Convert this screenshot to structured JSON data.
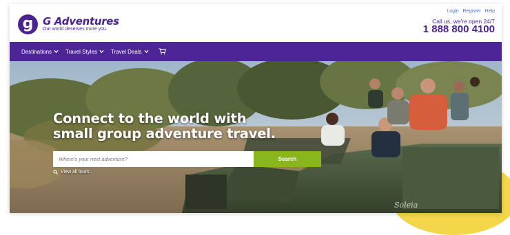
{
  "brand": {
    "name": "G Adventures",
    "tagline": "Our world deserves more you.",
    "logo_letter": "g"
  },
  "utility_links": [
    "Login",
    "Register",
    "Help"
  ],
  "contact": {
    "call_text": "Call us, we're open 24/7",
    "phone": "1 888 800 4100"
  },
  "nav": {
    "items": [
      {
        "label": "Destinations",
        "icon": "chevron-down-icon"
      },
      {
        "label": "Travel Styles",
        "icon": "chevron-down-icon"
      },
      {
        "label": "Travel Deals",
        "icon": "chevron-down-icon"
      }
    ],
    "cart_icon": "cart-icon"
  },
  "hero": {
    "headline_line1": "Connect to the world with",
    "headline_line2": "small group adventure travel.",
    "search_placeholder": "Where's your next adventure?",
    "search_button": "Search",
    "view_all": "View all tours",
    "vehicle_text": "Soleia"
  },
  "colors": {
    "brand_purple": "#4e2596",
    "search_green": "#8ab61d",
    "accent_yellow": "#f4d64a"
  }
}
